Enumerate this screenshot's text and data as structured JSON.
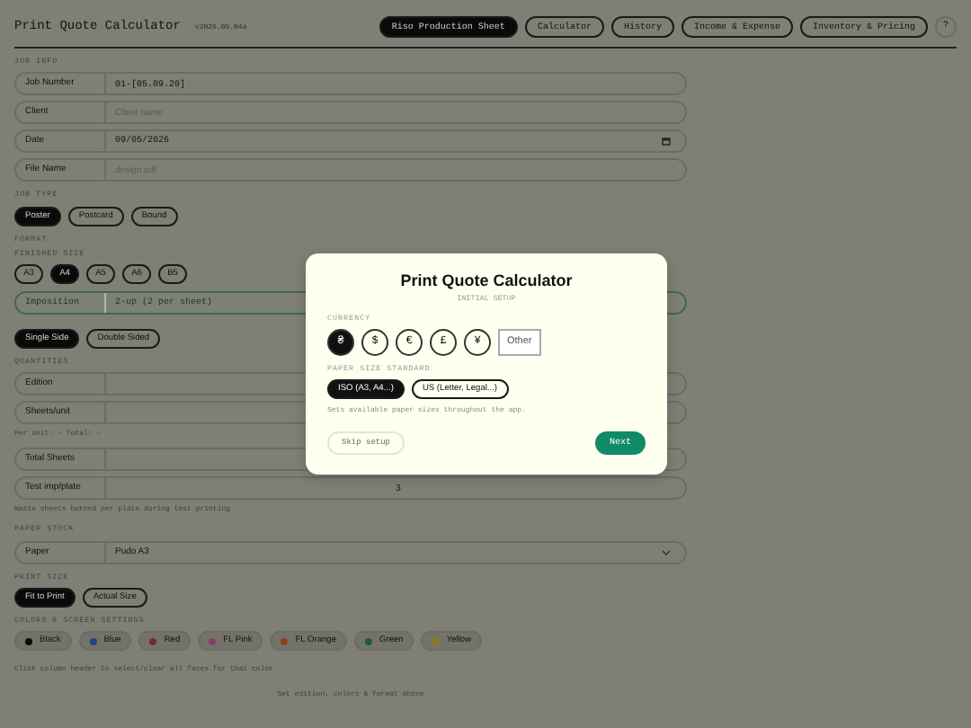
{
  "header": {
    "title": "Print Quote Calculator",
    "version": "v2026.09.04a"
  },
  "nav": [
    {
      "label": "Riso Production Sheet",
      "selected": true
    },
    {
      "label": "Calculator",
      "selected": false
    },
    {
      "label": "History",
      "selected": false
    },
    {
      "label": "Income & Expense",
      "selected": false
    },
    {
      "label": "Inventory & Pricing",
      "selected": false
    }
  ],
  "help_button": "?",
  "job_info": {
    "heading": "JOB INFO",
    "fields": [
      {
        "label": "Job Number",
        "kind": "text",
        "value": "01-[05.09.20]"
      },
      {
        "label": "Client",
        "kind": "text",
        "placeholder": "Client name"
      },
      {
        "label": "Date",
        "kind": "date",
        "value": "09/05/2026"
      },
      {
        "label": "File Name",
        "kind": "text",
        "placeholder": "design.pdf"
      }
    ]
  },
  "job_type": {
    "heading": "JOB TYPE",
    "options": [
      {
        "label": "Poster",
        "selected": true
      },
      {
        "label": "Postcard",
        "selected": false
      },
      {
        "label": "Bound",
        "selected": false
      }
    ]
  },
  "format": {
    "heading": "FORMAT",
    "subheading": "FINISHED SIZE",
    "sizes": [
      {
        "label": "A3",
        "selected": false
      },
      {
        "label": "A4",
        "selected": true
      },
      {
        "label": "A5",
        "selected": false
      },
      {
        "label": "A6",
        "selected": false
      },
      {
        "label": "B5",
        "selected": false
      }
    ],
    "imposition": {
      "label": "Imposition",
      "value": "2-up (2 per sheet)"
    },
    "sides": [
      {
        "label": "Single Side",
        "selected": true
      },
      {
        "label": "Double Sided",
        "selected": false
      }
    ]
  },
  "quantities": {
    "heading": "QUANTITIES",
    "items": [
      {
        "kind": "field",
        "label": "Edition"
      },
      {
        "kind": "field",
        "label": "Sheets/unit"
      },
      {
        "kind": "note",
        "text": "Per unit: –  Total: –"
      },
      {
        "kind": "field",
        "label": "Total Sheets"
      },
      {
        "kind": "field",
        "label": "Test imp/plate",
        "value": "3"
      },
      {
        "kind": "note",
        "text": "Waste sheets burned per plate during test printing"
      }
    ]
  },
  "paper_stock": {
    "heading": "PAPER STOCK",
    "label": "Paper",
    "value": "Pudo A3"
  },
  "print_size": {
    "heading": "PRINT SIZE",
    "options": [
      {
        "label": "Fit to Print",
        "selected": true
      },
      {
        "label": "Actual Size",
        "selected": false
      }
    ]
  },
  "colors": {
    "heading": "COLORS & SCREEN SETTINGS",
    "chips": [
      {
        "label": "Black",
        "color": "#0a0a0a"
      },
      {
        "label": "Blue",
        "color": "#1c4a78"
      },
      {
        "label": "Red",
        "color": "#7c2a2c"
      },
      {
        "label": "FL Pink",
        "color": "#8c3f66"
      },
      {
        "label": "FL Orange",
        "color": "#8c4218"
      },
      {
        "label": "Green",
        "color": "#1e5a36"
      },
      {
        "label": "Yellow",
        "color": "#8a7a18"
      }
    ],
    "hint": "Click column header to select/clear all faces for that color"
  },
  "footer_note": "Set edition, colors & format above",
  "modal": {
    "title": "Print Quote Calculator",
    "subtitle": "INITIAL SETUP",
    "currency": {
      "heading": "CURRENCY",
      "options": [
        {
          "label": "₴",
          "kind": "circle",
          "selected": true
        },
        {
          "label": "$",
          "kind": "circle",
          "selected": false
        },
        {
          "label": "€",
          "kind": "circle",
          "selected": false
        },
        {
          "label": "£",
          "kind": "circle",
          "selected": false
        },
        {
          "label": "¥",
          "kind": "circle",
          "selected": false
        },
        {
          "label": "Other",
          "kind": "text",
          "selected": false
        }
      ]
    },
    "paper_standard": {
      "heading": "PAPER SIZE STANDARD",
      "options": [
        {
          "label": "ISO (A3, A4...)",
          "selected": true
        },
        {
          "label": "US (Letter, Legal...)",
          "selected": false
        }
      ],
      "hint": "Sets available paper sizes throughout the app."
    },
    "skip": "Skip setup",
    "next": "Next"
  }
}
